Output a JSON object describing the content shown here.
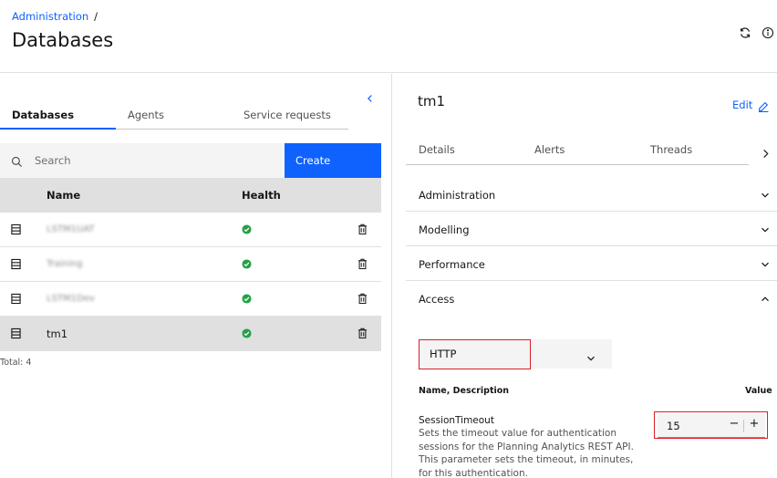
{
  "header": {
    "breadcrumb_link": "Administration",
    "breadcrumb_sep": "/",
    "title": "Databases",
    "icons": [
      "refresh-icon",
      "info-icon"
    ]
  },
  "left": {
    "tabs": [
      {
        "label": "Databases",
        "active": true
      },
      {
        "label": "Agents",
        "active": false
      },
      {
        "label": "Service requests",
        "active": false
      }
    ],
    "search": {
      "placeholder": "Search",
      "value": ""
    },
    "create_label": "Create",
    "table": {
      "columns": [
        "Name",
        "Health"
      ],
      "rows": [
        {
          "name": "LSTM1UAT",
          "health": "healthy",
          "obscured": true
        },
        {
          "name": "Training",
          "health": "healthy",
          "obscured": true
        },
        {
          "name": "LSTM1Dev",
          "health": "healthy",
          "obscured": true
        },
        {
          "name": "tm1",
          "health": "healthy",
          "obscured": false,
          "selected": true
        }
      ]
    },
    "total": "Total: 4"
  },
  "right": {
    "title": "tm1",
    "edit_label": "Edit",
    "tabs": [
      "Details",
      "Alerts",
      "Threads"
    ],
    "sections": [
      {
        "label": "Administration",
        "open": false
      },
      {
        "label": "Modelling",
        "open": false
      },
      {
        "label": "Performance",
        "open": false
      },
      {
        "label": "Access",
        "open": true
      }
    ],
    "access": {
      "protocol": "HTTP",
      "col_name": "Name, Description",
      "col_value": "Value",
      "param": {
        "name": "SessionTimeout",
        "description": "Sets the timeout value for authentication sessions for the Planning Analytics REST API. This parameter sets the timeout, in minutes, for this authentication.",
        "value": "15",
        "minus": "−",
        "plus": "+"
      }
    }
  },
  "colors": {
    "accent": "#0f62fe",
    "success": "#24a148",
    "highlight": "#da1e28"
  }
}
